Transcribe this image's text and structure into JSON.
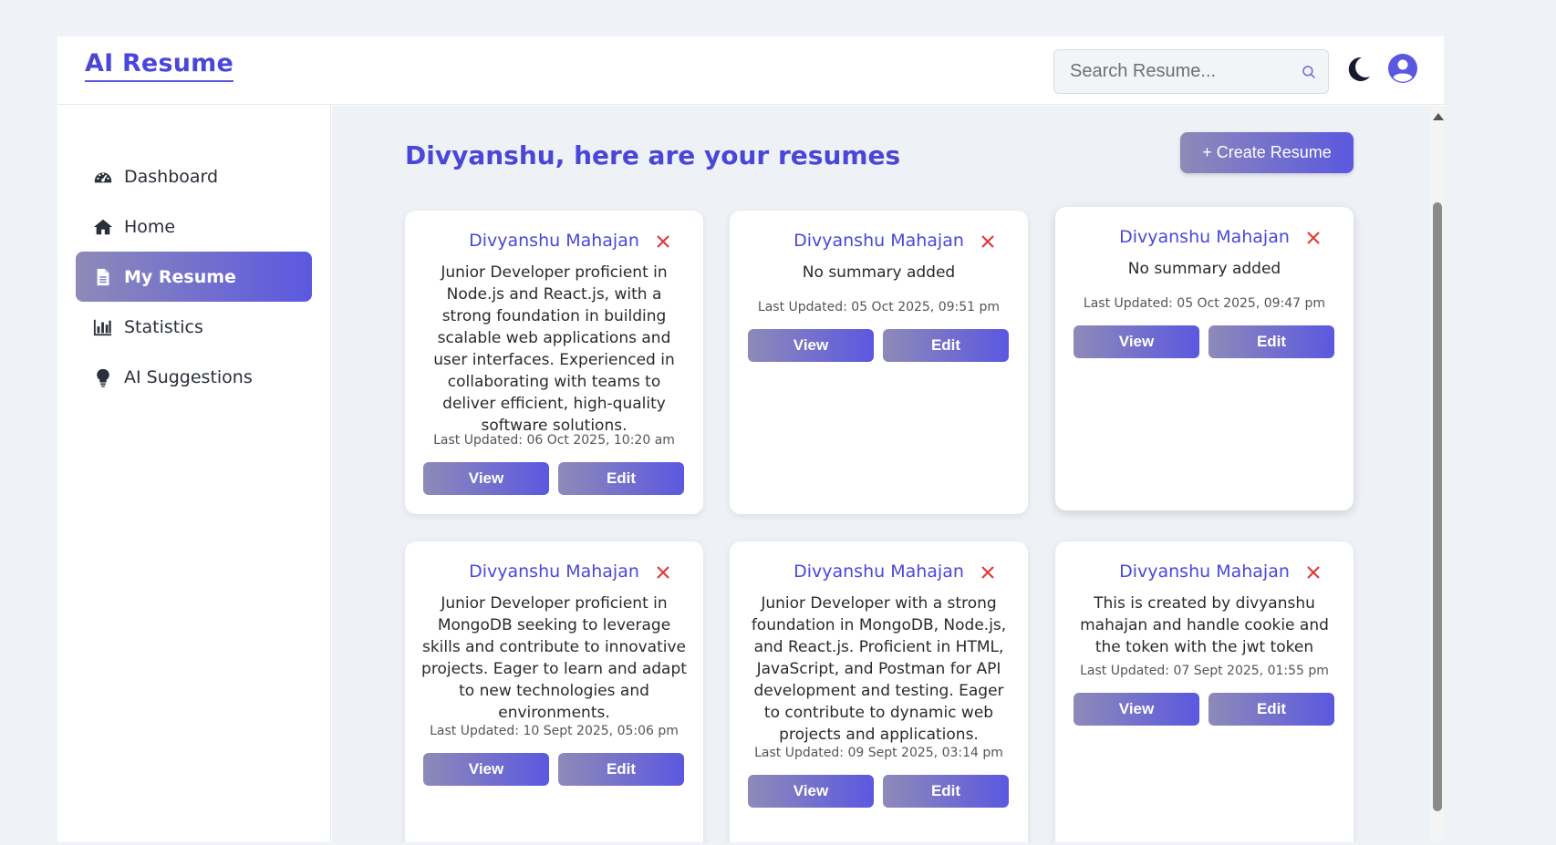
{
  "app": {
    "brand": "AI Resume"
  },
  "header": {
    "search_placeholder": "Search Resume...",
    "theme_icon": "moon-icon",
    "profile_icon": "user-icon"
  },
  "sidebar": {
    "items": [
      {
        "label": "Dashboard",
        "icon": "dashboard-icon",
        "active": false
      },
      {
        "label": "Home",
        "icon": "home-icon",
        "active": false
      },
      {
        "label": "My Resume",
        "icon": "file-icon",
        "active": true
      },
      {
        "label": "Statistics",
        "icon": "chart-icon",
        "active": false
      },
      {
        "label": "AI Suggestions",
        "icon": "lightbulb-icon",
        "active": false
      }
    ]
  },
  "main": {
    "title": "Divyanshu, here are your resumes",
    "create_label": "+ Create Resume",
    "view_label": "View",
    "edit_label": "Edit",
    "cards": [
      {
        "name": "Divyanshu Mahajan",
        "summary": "Junior Developer proficient in Node.js and React.js, with a strong foundation in building scalable web applications and user interfaces. Experienced in collaborating with teams to deliver efficient, high-quality software solutions.",
        "updated": "Last Updated: 06 Oct 2025, 10:20 am"
      },
      {
        "name": "Divyanshu Mahajan",
        "summary": "No summary added",
        "updated": "Last Updated: 05 Oct 2025, 09:51 pm"
      },
      {
        "name": "Divyanshu Mahajan",
        "summary": "No summary added",
        "updated": "Last Updated: 05 Oct 2025, 09:47 pm"
      },
      {
        "name": "Divyanshu Mahajan",
        "summary": "Junior Developer proficient in MongoDB seeking to leverage skills and contribute to innovative projects. Eager to learn and adapt to new technologies and environments.",
        "updated": "Last Updated: 10 Sept 2025, 05:06 pm"
      },
      {
        "name": "Divyanshu Mahajan",
        "summary": "Junior Developer with a strong foundation in MongoDB, Node.js, and React.js. Proficient in HTML, JavaScript, and Postman for API development and testing. Eager to contribute to dynamic web projects and applications.",
        "updated": "Last Updated: 09 Sept 2025, 03:14 pm"
      },
      {
        "name": "Divyanshu Mahajan",
        "summary": "This is created by divyanshu mahajan and handle cookie and the token with the jwt token",
        "updated": "Last Updated: 07 Sept 2025, 01:55 pm"
      }
    ]
  },
  "colors": {
    "accent": "#4a47d8",
    "delete": "#e03a3a",
    "gradient_start": "#8e8ab8",
    "gradient_end": "#5b58e0"
  }
}
